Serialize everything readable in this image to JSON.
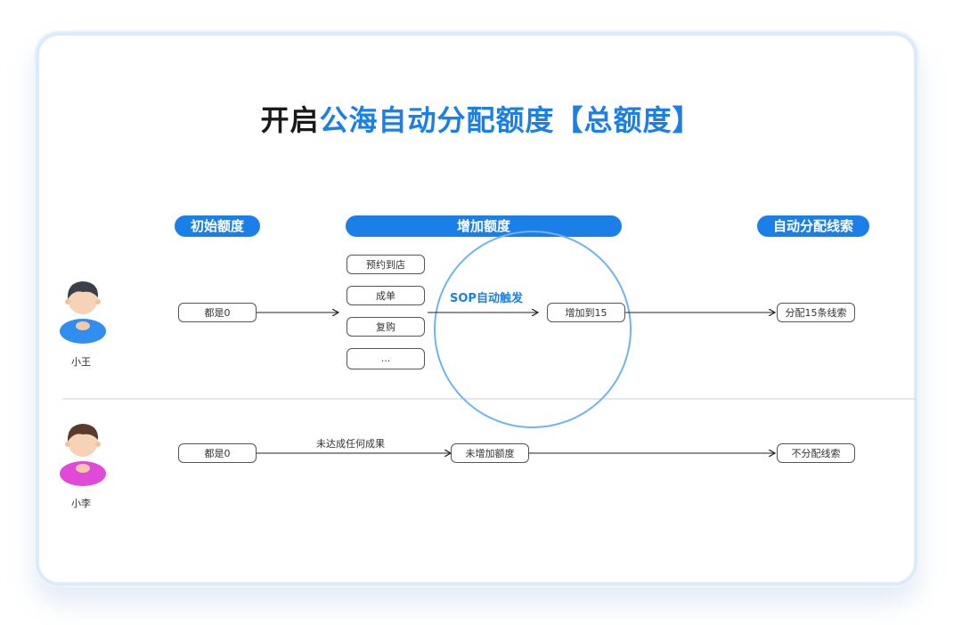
{
  "title": {
    "part1": "开启",
    "part2": "公海自动分配额度【总额度】"
  },
  "headers": {
    "initial": "初始额度",
    "increase": "增加额度",
    "assign": "自动分配线索"
  },
  "row1": {
    "person": "小王",
    "initial": "都是0",
    "triggers": [
      "预约到店",
      "成单",
      "复购",
      "..."
    ],
    "sop_label": "SOP自动触发",
    "increased": "增加到15",
    "result": "分配15条线索"
  },
  "row2": {
    "person": "小李",
    "initial": "都是0",
    "edge_label": "未达成任何成果",
    "increased": "未增加额度",
    "result": "不分配线索"
  },
  "colors": {
    "accent": "#1b7fe8",
    "circle": "#6fb3f2",
    "avatar1_shirt": "#2f8ef0",
    "avatar2_shirt": "#e14ad8"
  }
}
